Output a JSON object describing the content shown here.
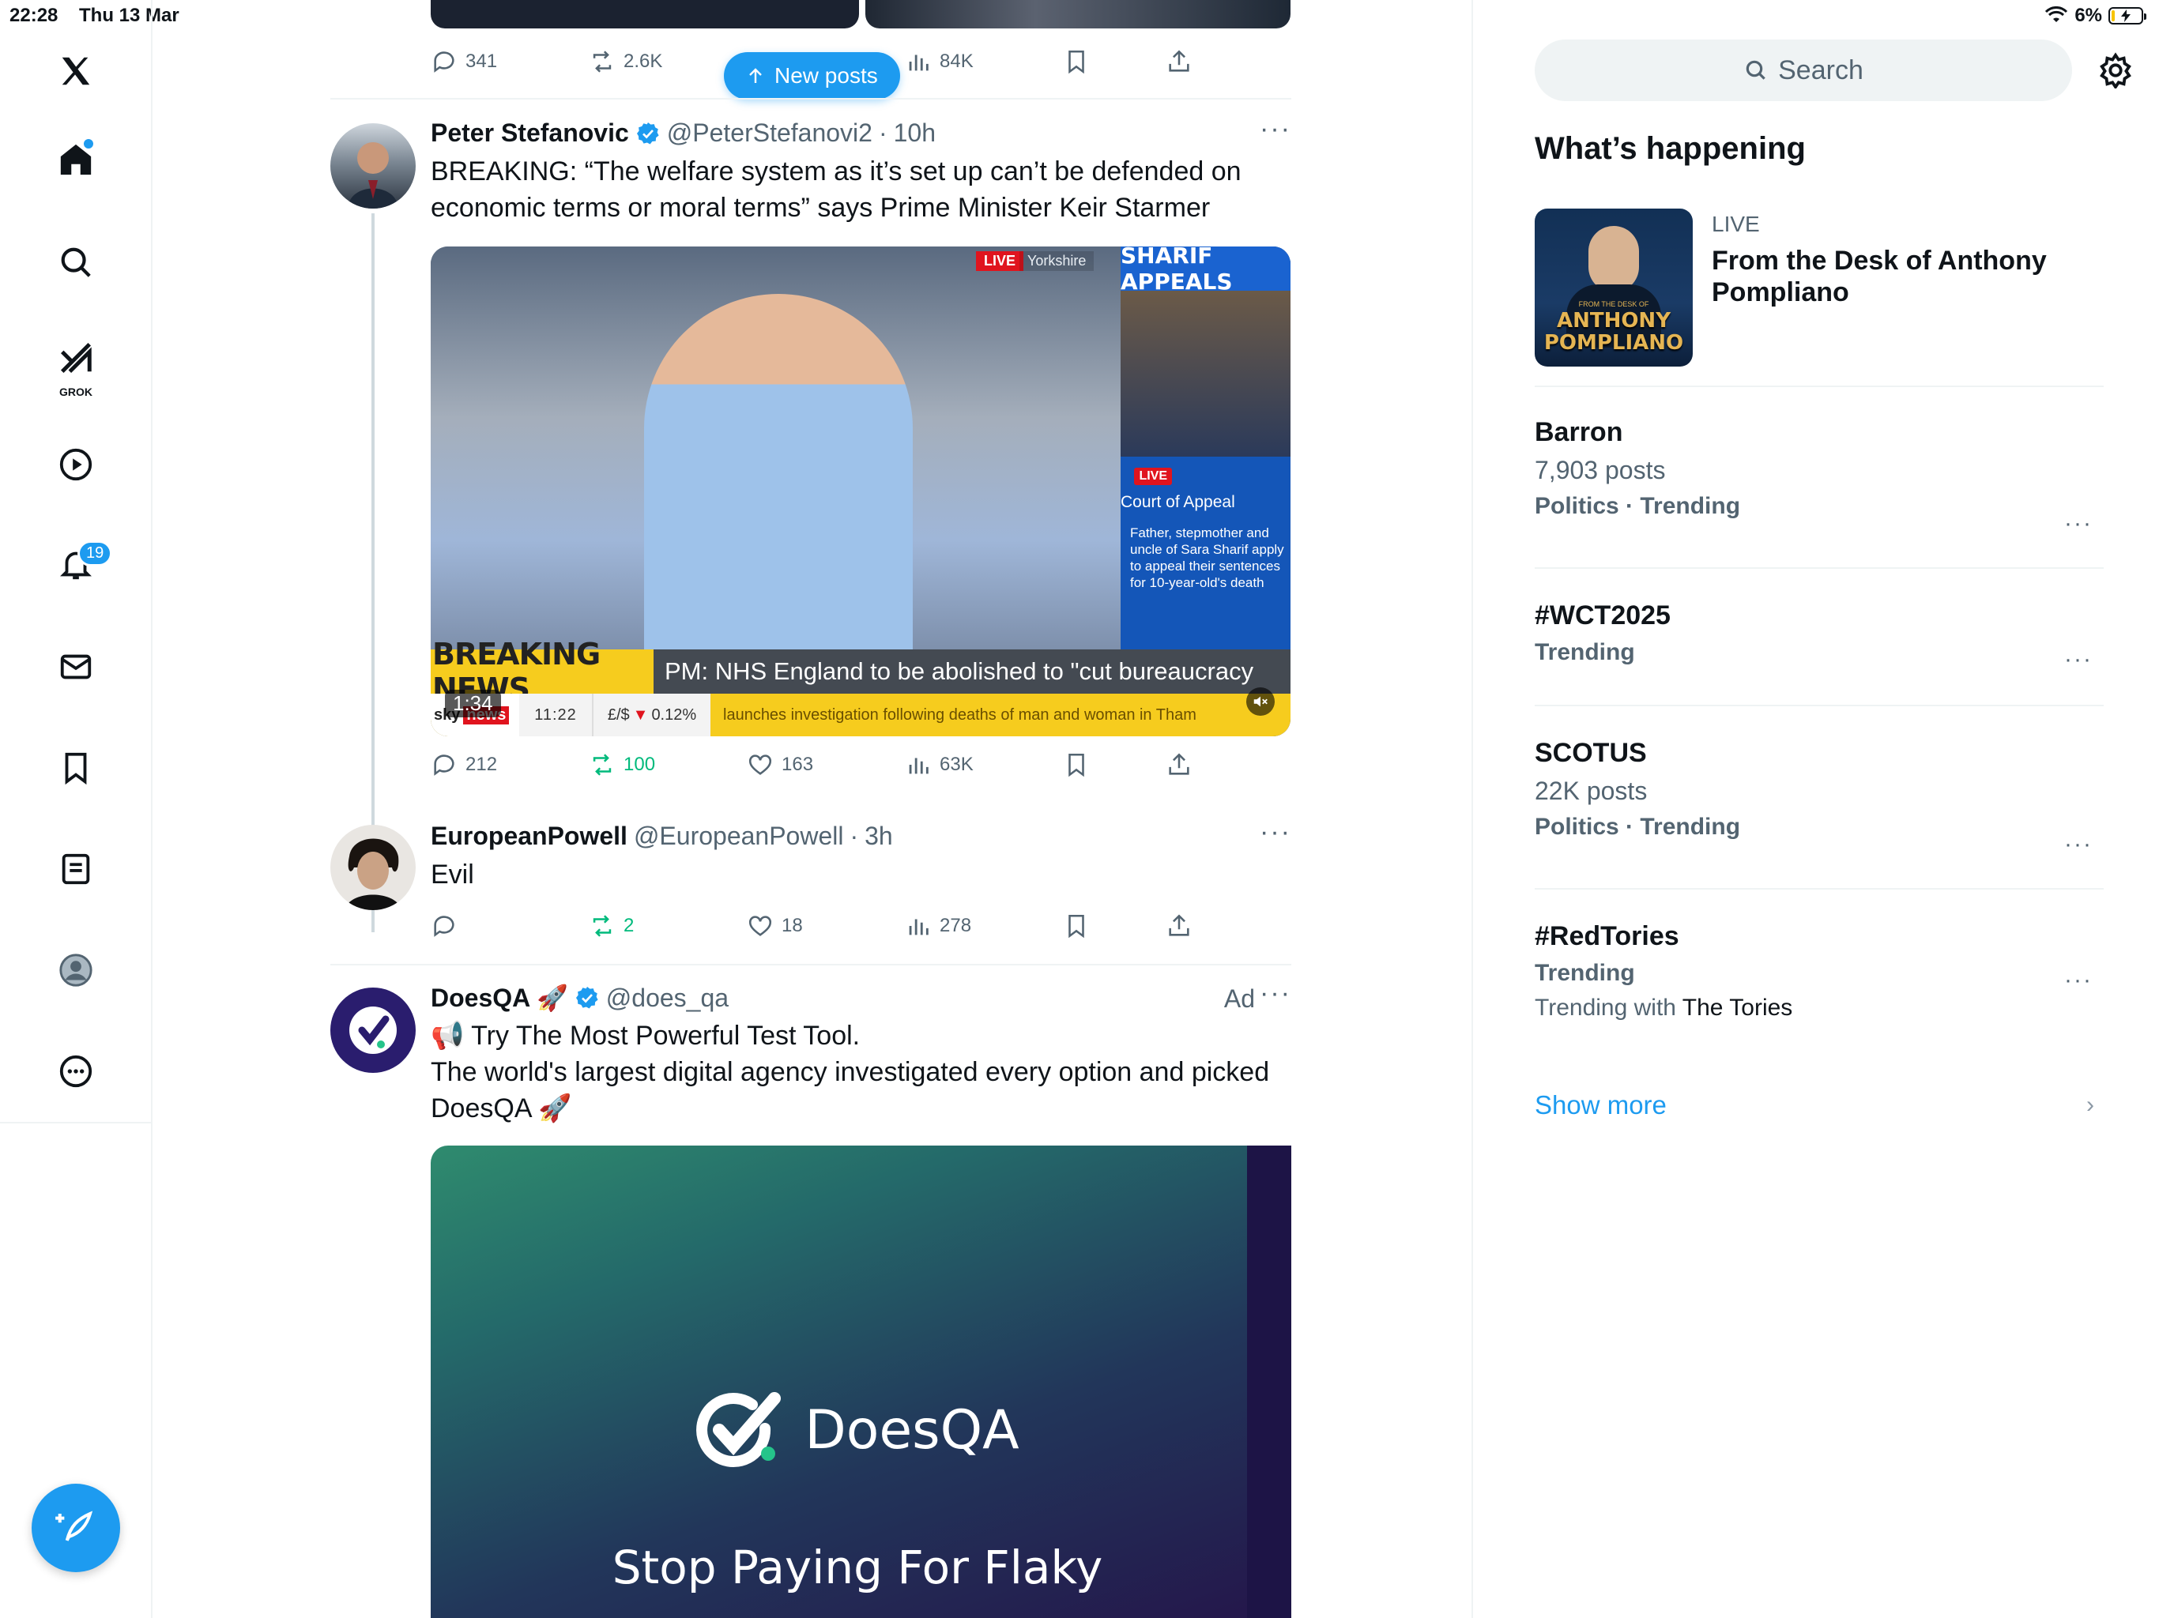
{
  "status_bar": {
    "time": "22:28",
    "date": "Thu 13 Mar",
    "battery": "6%"
  },
  "nav": {
    "notifications_badge": "19",
    "grok_label": "GROK"
  },
  "feed": {
    "top_post_actions": {
      "replies": "341",
      "reposts": "2.6K",
      "views": "84K"
    },
    "new_posts_label": "New posts",
    "post1": {
      "name": "Peter Stefanovic",
      "handle": "@PeterStefanovi2",
      "time": "10h",
      "text": "BREAKING: “The welfare system as it’s set up can’t be defended on economic terms or moral terms” says Prime Minister Keir Starmer",
      "video": {
        "top_live": "LIVE",
        "top_region": "Yorkshire",
        "side_header": "SHARIF APPEALS",
        "side_live": "LIVE",
        "side_title": "Court of Appeal",
        "side_body": "Father, stepmother and uncle of Sara Sharif apply to appeal their sentences for 10-year-old's death",
        "breaking": "BREAKING NEWS",
        "headline": "PM: NHS England to be abolished to \"cut bureaucracy",
        "sky": "sky",
        "news": "news",
        "clock": "11:22",
        "fx_label": "£/$",
        "fx_value": "0.12%",
        "lower_text": "launches investigation following deaths of man and woman in Tham",
        "duration": "1:34"
      },
      "actions": {
        "replies": "212",
        "reposts": "100",
        "likes": "163",
        "views": "63K"
      }
    },
    "post2": {
      "name": "EuropeanPowell",
      "handle": "@EuropeanPowell",
      "time": "3h",
      "text": "Evil",
      "actions": {
        "reposts": "2",
        "likes": "18",
        "views": "278"
      }
    },
    "post3": {
      "name": "DoesQA 🚀",
      "handle": "@does_qa",
      "ad_label": "Ad",
      "text_line1": "📢 Try The Most Powerful Test Tool.",
      "text_line2": "The world's largest digital agency investigated every option and picked DoesQA 🚀",
      "card_brand": "DoesQA",
      "card_tagline": "Stop Paying For Flaky"
    }
  },
  "right": {
    "search_placeholder": "Search",
    "section_title": "What’s happening",
    "live": {
      "label": "LIVE",
      "title": "From the Desk of Anthony Pompliano",
      "thumb_pre": "FROM THE DESK OF",
      "thumb_name": "ANTHONY POMPLIANO"
    },
    "trends": [
      {
        "name": "Barron",
        "count": "7,903 posts",
        "category": "Politics · Trending"
      },
      {
        "name": "#WCT2025",
        "category": "Trending"
      },
      {
        "name": "SCOTUS",
        "count": "22K posts",
        "category": "Politics · Trending"
      },
      {
        "name": "#RedTories",
        "category": "Trending",
        "with_prefix": "Trending with",
        "with_name": "The Tories"
      }
    ],
    "show_more": "Show more"
  },
  "colors": {
    "accent": "#1d9bf0",
    "repost_green": "#00ba7c",
    "muted": "#536471"
  }
}
